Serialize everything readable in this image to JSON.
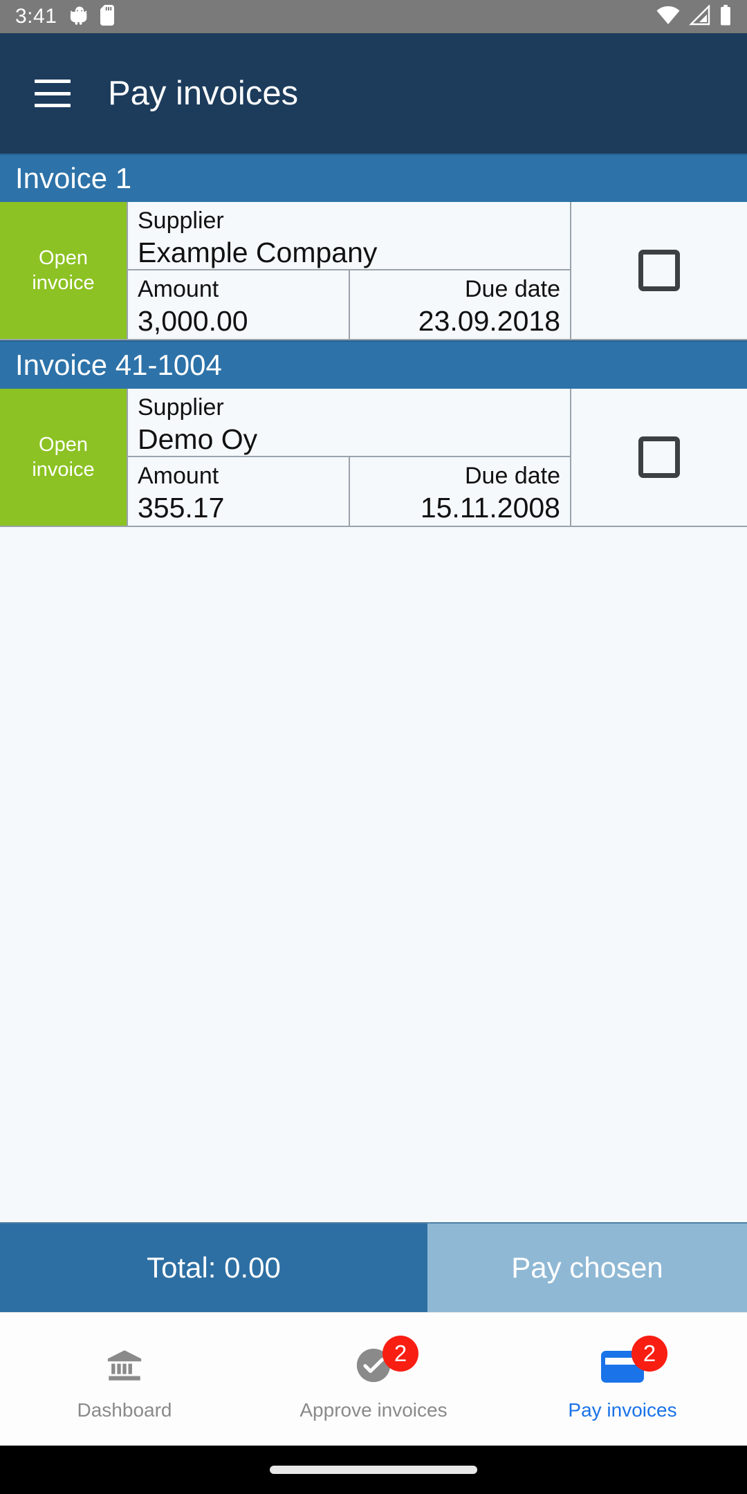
{
  "status_bar": {
    "time": "3:41",
    "left_icons": [
      "android-gear-icon",
      "sd-card-icon"
    ],
    "right_icons": [
      "wifi-icon",
      "cellular-signal-icon",
      "battery-icon"
    ],
    "background_color": "#7a7a7a"
  },
  "app_bar": {
    "menu_icon": "hamburger-menu-icon",
    "title": "Pay invoices",
    "background_color": "#1d3c5c"
  },
  "invoices": [
    {
      "header": "Invoice 1",
      "status": "Open\ninvoice",
      "status_line1": "Open",
      "status_line2": "invoice",
      "status_color": "#8cc223",
      "supplier_label": "Supplier",
      "supplier_value": "Example Company",
      "amount_label": "Amount",
      "amount_value": "3,000.00",
      "due_label": "Due date",
      "due_value": "23.09.2018",
      "checked": false
    },
    {
      "header": "Invoice 41-1004",
      "status": "Open\ninvoice",
      "status_line1": "Open",
      "status_line2": "invoice",
      "status_color": "#8cc223",
      "supplier_label": "Supplier",
      "supplier_value": "Demo Oy",
      "amount_label": "Amount",
      "amount_value": "355.17",
      "due_label": "Due date",
      "due_value": "15.11.2008",
      "checked": false
    }
  ],
  "bottom_bar": {
    "total_label": "Total: 0.00",
    "pay_button_label": "Pay chosen",
    "total_color": "#2d6fa3",
    "pay_color": "#8fb8d4"
  },
  "tabs": [
    {
      "label": "Dashboard",
      "icon": "bank-icon",
      "badge": null,
      "active": false
    },
    {
      "label": "Approve invoices",
      "icon": "check-circle-icon",
      "badge": "2",
      "active": false
    },
    {
      "label": "Pay invoices",
      "icon": "credit-card-icon",
      "badge": "2",
      "active": true
    }
  ],
  "accent_color": "#1a73e8",
  "badge_color": "#f81e12",
  "section_header_color": "#2d72a8",
  "gesture_bar": {
    "handle": "home-gesture-pill"
  }
}
